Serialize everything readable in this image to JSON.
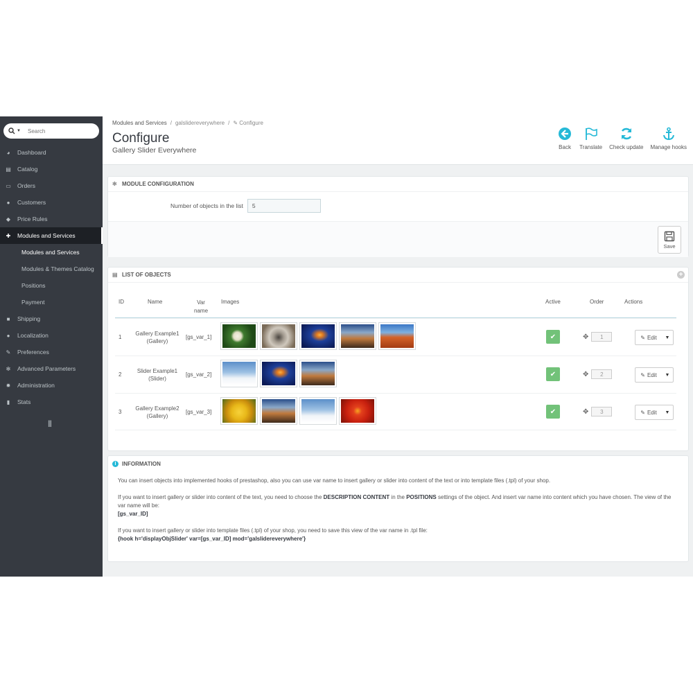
{
  "search": {
    "placeholder": "Search"
  },
  "menu": [
    {
      "label": "Dashboard",
      "icon": "dashboard-icon"
    },
    {
      "label": "Catalog",
      "icon": "book-icon"
    },
    {
      "label": "Orders",
      "icon": "credit-card-icon"
    },
    {
      "label": "Customers",
      "icon": "users-icon"
    },
    {
      "label": "Price Rules",
      "icon": "tags-icon"
    },
    {
      "label": "Modules and Services",
      "icon": "puzzle-icon"
    }
  ],
  "submenu": [
    "Modules and Services",
    "Modules & Themes Catalog",
    "Positions",
    "Payment"
  ],
  "menu2": [
    {
      "label": "Shipping",
      "icon": "truck-icon"
    },
    {
      "label": "Localization",
      "icon": "globe-icon"
    },
    {
      "label": "Preferences",
      "icon": "wrench-icon"
    },
    {
      "label": "Advanced Parameters",
      "icon": "cogs-icon"
    },
    {
      "label": "Administration",
      "icon": "cog-icon"
    },
    {
      "label": "Stats",
      "icon": "bar-chart-icon"
    }
  ],
  "breadcrumb": {
    "item1": "Modules and Services",
    "sep": "/",
    "item2": "galslidereverywhere",
    "item3": "Configure"
  },
  "header": {
    "title": "Configure",
    "subtitle": "Gallery Slider Everywhere"
  },
  "toolbar": [
    {
      "label": "Back",
      "icon": "back-arrow-icon"
    },
    {
      "label": "Translate",
      "icon": "flag-icon"
    },
    {
      "label": "Check update",
      "icon": "refresh-icon"
    },
    {
      "label": "Manage hooks",
      "icon": "anchor-icon"
    }
  ],
  "config": {
    "heading": "MODULE CONFIGURATION",
    "field_label": "Number of objects in the list",
    "field_value": "5",
    "save_label": "Save"
  },
  "list": {
    "heading": "LIST OF OBJECTS",
    "columns": {
      "id": "ID",
      "name": "Name",
      "var1": "Var",
      "var2": "name",
      "images": "Images",
      "active": "Active",
      "order": "Order",
      "actions": "Actions"
    },
    "rows": [
      {
        "id": "1",
        "name1": "Gallery Example1",
        "name2": "(Gallery)",
        "var": "[gs_var_1]",
        "order": "1",
        "edit": "Edit",
        "images": [
          "flower",
          "koala",
          "jellyfish",
          "lighthouse",
          "desert"
        ]
      },
      {
        "id": "2",
        "name1": "Slider Example1",
        "name2": "(Slider)",
        "var": "[gs_var_2]",
        "order": "2",
        "edit": "Edit",
        "images": [
          "penguins",
          "jellyfish",
          "lighthouse"
        ]
      },
      {
        "id": "3",
        "name1": "Gallery Example2",
        "name2": "(Gallery)",
        "var": "[gs_var_3]",
        "order": "3",
        "edit": "Edit",
        "images": [
          "tulips",
          "lighthouse",
          "penguins",
          "chrysanthemum"
        ]
      }
    ]
  },
  "info": {
    "heading": "INFORMATION",
    "p1": "You can insert objects into implemented hooks of prestashop, also you can use var name to insert gallery or slider into content of the text or into template files (.tpl) of your shop.",
    "p2a": "If you want to insert gallery or slider into content of the text, you need to choose the ",
    "p2b": "DESCRIPTION CONTENT",
    "p2c": " in the ",
    "p2d": "POSITIONS",
    "p2e": " settings of the object. And insert var name into content which you have chosen. The view of the var name will be:",
    "p2code": "[gs_var_ID]",
    "p3": "If you want to insert gallery or slider into template files (.tpl) of your shop, you need to save this view of the var name in .tpl file:",
    "p3code": "{hook h='displayObjSlider' var=[gs_var_ID] mod='galslidereverywhere'}"
  },
  "colors": {
    "sidebar": "#363a41",
    "accent": "#25b9d7",
    "active_green": "#72c279"
  }
}
